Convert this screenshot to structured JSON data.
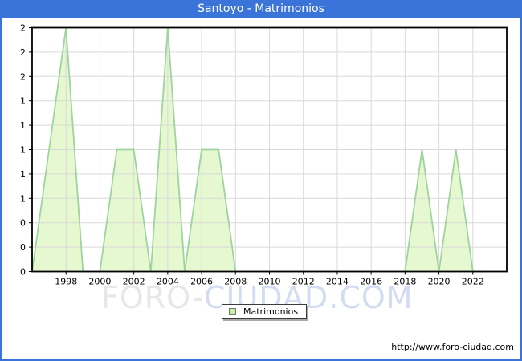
{
  "titlebar": {
    "title": "Santoyo - Matrimonios",
    "bg_color": "#3b74d8",
    "text_color": "#ffffff"
  },
  "watermark": {
    "part1": "FORO-",
    "part2": "CIUDAD.COM"
  },
  "legend": {
    "label": "Matrimonios",
    "swatch_color": "#c6ef9e"
  },
  "footer": {
    "url": "http://www.foro-ciudad.com"
  },
  "chart_data": {
    "type": "area",
    "title": "Santoyo - Matrimonios",
    "xlabel": "",
    "ylabel": "",
    "series": [
      {
        "name": "Matrimonios",
        "x": [
          1996,
          1997,
          1998,
          1999,
          2000,
          2001,
          2002,
          2003,
          2004,
          2005,
          2006,
          2007,
          2008,
          2009,
          2010,
          2011,
          2012,
          2013,
          2014,
          2015,
          2016,
          2017,
          2018,
          2019,
          2020,
          2021,
          2022,
          2023
        ],
        "values": [
          0,
          1,
          2,
          0,
          0,
          1,
          1,
          0,
          2,
          0,
          1,
          1,
          0,
          0,
          0,
          0,
          0,
          0,
          0,
          0,
          0,
          0,
          0,
          1,
          0,
          1,
          0,
          0
        ]
      }
    ],
    "xlim": [
      1996,
      2024
    ],
    "ylim": [
      0,
      2
    ],
    "xtick_values": [
      1998,
      2000,
      2002,
      2004,
      2006,
      2008,
      2010,
      2012,
      2014,
      2016,
      2018,
      2020,
      2022
    ],
    "xtick_labels": [
      "1998",
      "2000",
      "2002",
      "2004",
      "2006",
      "2008",
      "2010",
      "2012",
      "2014",
      "2016",
      "2018",
      "2020",
      "2022"
    ],
    "ytick_values": [
      0,
      0.2,
      0.4,
      0.6,
      0.8,
      1.0,
      1.2,
      1.4,
      1.6,
      1.8,
      2.0
    ],
    "ytick_labels": [
      "0",
      "0",
      "0",
      "1",
      "1",
      "1",
      "1",
      "1",
      "2",
      "2",
      "2"
    ],
    "grid": true,
    "legend_position": "bottom-center",
    "colors": {
      "fill": "#e6f8d0",
      "stroke": "#9ed49e",
      "grid": "#d9d9d9",
      "axis": "#000000",
      "tick_text": "#000000"
    }
  }
}
